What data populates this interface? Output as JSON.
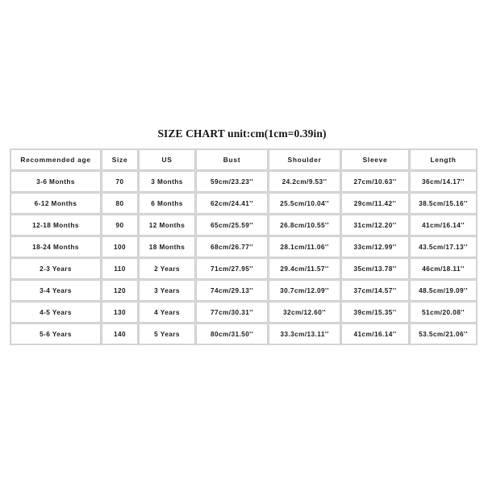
{
  "title": "SIZE CHART unit:cm(1cm=0.39in)",
  "chart_data": {
    "type": "table",
    "title": "SIZE CHART unit:cm(1cm=0.39in)",
    "columns": [
      "Recommended age",
      "Size",
      "US",
      "Bust",
      "Shoulder",
      "Sleeve",
      "Length"
    ],
    "rows": [
      [
        "3-6 Months",
        "70",
        "3 Months",
        "59cm/23.23''",
        "24.2cm/9.53''",
        "27cm/10.63''",
        "36cm/14.17''"
      ],
      [
        "6-12 Months",
        "80",
        "6 Months",
        "62cm/24.41''",
        "25.5cm/10.04''",
        "29cm/11.42''",
        "38.5cm/15.16''"
      ],
      [
        "12-18 Months",
        "90",
        "12 Months",
        "65cm/25.59''",
        "26.8cm/10.55''",
        "31cm/12.20''",
        "41cm/16.14''"
      ],
      [
        "18-24 Months",
        "100",
        "18 Months",
        "68cm/26.77''",
        "28.1cm/11.06''",
        "33cm/12.99''",
        "43.5cm/17.13''"
      ],
      [
        "2-3 Years",
        "110",
        "2 Years",
        "71cm/27.95''",
        "29.4cm/11.57''",
        "35cm/13.78''",
        "46cm/18.11''"
      ],
      [
        "3-4 Years",
        "120",
        "3 Years",
        "74cm/29.13''",
        "30.7cm/12.09''",
        "37cm/14.57''",
        "48.5cm/19.09''"
      ],
      [
        "4-5 Years",
        "130",
        "4 Years",
        "77cm/30.31''",
        "32cm/12.60''",
        "39cm/15.35''",
        "51cm/20.08''"
      ],
      [
        "5-6 Years",
        "140",
        "5 Years",
        "80cm/31.50''",
        "33.3cm/13.11''",
        "41cm/16.14''",
        "53.5cm/21.06''"
      ]
    ],
    "units_note": "unit:cm(1cm=0.39in)",
    "background_color": "#ffffff",
    "border_color": "#cfcfcf",
    "text_color": "#1a1a1a"
  }
}
